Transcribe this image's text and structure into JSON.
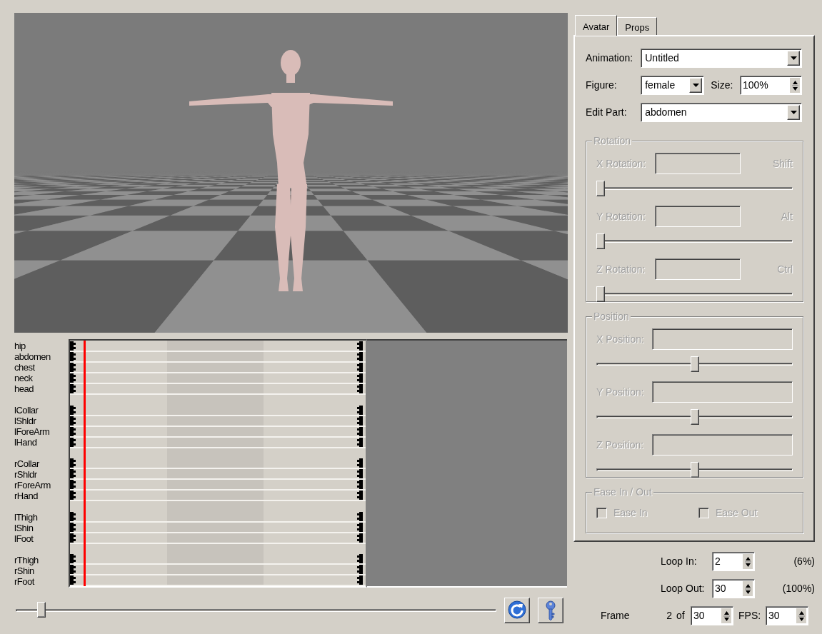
{
  "timeline": {
    "tracks": [
      {
        "parts": [
          "hip",
          "abdomen",
          "chest",
          "neck",
          "head"
        ]
      },
      {
        "parts": [
          "lCollar",
          "lShldr",
          "lForeArm",
          "lHand"
        ]
      },
      {
        "parts": [
          "rCollar",
          "rShldr",
          "rForeArm",
          "rHand"
        ]
      },
      {
        "parts": [
          "lThigh",
          "lShin",
          "lFoot"
        ]
      },
      {
        "parts": [
          "rThigh",
          "rShin",
          "rFoot"
        ]
      }
    ],
    "playhead": {
      "level": 0.045
    }
  },
  "frame_slider": {
    "level": 0.045
  },
  "toolbar_buttons": [
    {
      "kind": "refresh"
    },
    {
      "kind": "key"
    }
  ],
  "tabs": [
    {
      "label": "Avatar",
      "selected": true
    },
    {
      "label": "Props",
      "selected": false
    }
  ],
  "animation": {
    "label": "Animation:",
    "value": "Untitled"
  },
  "figure": {
    "label": "Figure:",
    "value": "female"
  },
  "size": {
    "label": "Size:",
    "value": "100%"
  },
  "edit_part": {
    "label": "Edit Part:",
    "value": "abdomen"
  },
  "rotation": {
    "title": "Rotation",
    "disabled": true,
    "rows": [
      {
        "label": "X Rotation:",
        "modifier": "Shift",
        "level": 0
      },
      {
        "label": "Y Rotation:",
        "modifier": "Alt",
        "level": 0
      },
      {
        "label": "Z Rotation:",
        "modifier": "Ctrl",
        "level": 0
      }
    ]
  },
  "position": {
    "title": "Position",
    "disabled": true,
    "rows": [
      {
        "label": "X Position:",
        "level": 0.5
      },
      {
        "label": "Y Position:",
        "level": 0.5
      },
      {
        "label": "Z Position:",
        "level": 0.5
      }
    ]
  },
  "ease": {
    "title": "Ease In / Out",
    "disabled": true,
    "options": [
      {
        "label": "Ease In",
        "checked": false
      },
      {
        "label": "Ease Out",
        "checked": false
      }
    ]
  },
  "loop_in": {
    "label": "Loop In:",
    "value": "2",
    "percent": "(6%)"
  },
  "loop_out": {
    "label": "Loop Out:",
    "value": "30",
    "percent": "(100%)"
  },
  "frame": {
    "label": "Frame",
    "current": "2",
    "of": "of",
    "total": "30",
    "fps_label": "FPS:",
    "fps": "30"
  }
}
